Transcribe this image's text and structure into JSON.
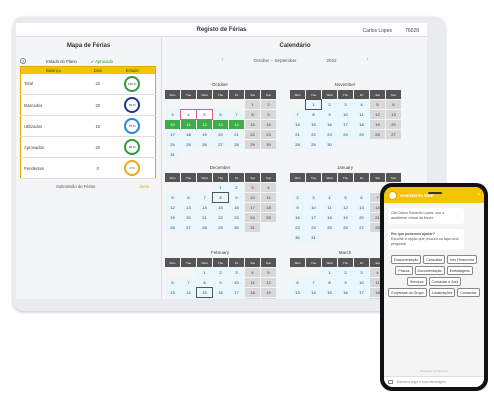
{
  "app": {
    "title": "Registo de Férias",
    "user": "Carlos Lopes",
    "user_id": "76028"
  },
  "left": {
    "title": "Mapa de Férias",
    "legend": {
      "status": "Estado do Plano",
      "approved": "✔ Aprovado"
    },
    "columns": [
      "Balanço",
      "Dias",
      "Estado"
    ],
    "rows": [
      {
        "label": "Total",
        "days": "22",
        "pct": "100 %",
        "color": "#2e9a3c"
      },
      {
        "label": "Marcados",
        "days": "20",
        "pct": "90 %",
        "color": "#1f3a8a"
      },
      {
        "label": "Utilizados",
        "days": "16",
        "pct": "75 %",
        "color": "#2a86d8"
      },
      {
        "label": "Aprovados",
        "days": "20",
        "pct": "90 %",
        "color": "#2e9a3c"
      },
      {
        "label": "Pendentes",
        "days": "0",
        "pct": "0 %",
        "color": "#f5a623"
      }
    ],
    "footer": {
      "submission": "Submissão de Férias",
      "jump": "Junta"
    }
  },
  "calendar": {
    "title": "Calendário",
    "range": "October – September",
    "year": "2022",
    "weekdays": [
      "Mon",
      "Tue",
      "Wed",
      "Thu",
      "Fri",
      "Sat",
      "Sun"
    ],
    "months": [
      {
        "name": "October",
        "offset": 5,
        "days": 31,
        "vac": [
          10,
          11,
          12,
          13,
          14
        ],
        "today": 4,
        "today2": 5
      },
      {
        "name": "November",
        "offset": 1,
        "days": 30,
        "vac": [],
        "sel": 1
      },
      {
        "name": "December",
        "offset": 3,
        "days": 31,
        "vac": [],
        "sel": 8
      },
      {
        "name": "January",
        "offset": 6,
        "days": 31,
        "vac": []
      },
      {
        "name": "February",
        "offset": 2,
        "days": 28,
        "vac": [],
        "sel": 15
      },
      {
        "name": "March",
        "offset": 2,
        "days": 31,
        "vac": []
      }
    ]
  },
  "chat": {
    "name": "Assistente Saúl",
    "greeting": "Olá Carlos Eduardo Lopes, sou o assistente virtual da Mech!",
    "question": "Em que podemos ajudar?",
    "hint": "Escolhe a opção que procura ou faça uma pergunta!",
    "options": [
      "Documentação",
      "Consultas",
      "Info Financeira",
      "Prazos",
      "Documentação",
      "Embalagens",
      "Serviços",
      "Contactar a Saúl",
      "Empresas do Grupo",
      "Localizações",
      "Contactos"
    ],
    "powered": "Powered by Mech.ai",
    "placeholder": "Escreva algo e sua mensagem"
  }
}
